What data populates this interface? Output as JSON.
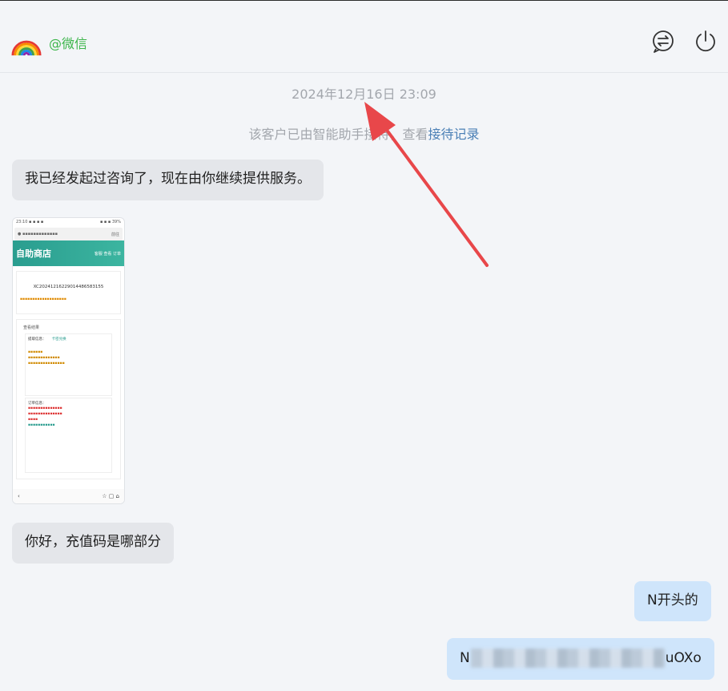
{
  "header": {
    "username": "@微信",
    "avatar_icon": "rainbow-icon",
    "switch_icon": "switch-chat-icon",
    "power_icon": "power-icon"
  },
  "chat": {
    "timestamp": "2024年12月16日 23:09",
    "notice_text": "该客户已由智能助手接待，查看",
    "notice_link": "接待记录",
    "messages": [
      {
        "side": "left",
        "text": "我已经发起过咨询了，现在由你继续提供服务。"
      },
      {
        "side": "left",
        "text": "你好，充值码是哪部分"
      },
      {
        "side": "right",
        "text": "N开头的"
      },
      {
        "side": "right",
        "prefix": "N",
        "suffix": "uOXo"
      }
    ]
  },
  "thumbnail": {
    "shop_title": "自助商店",
    "nav": "客服  查看  订单",
    "order_no": "XC20241216229014486583155",
    "tab_label": "查看结果",
    "section1": "提取信息：",
    "section1_link": "卡密兑换",
    "section2": "订单信息：",
    "go_btn": "前往"
  },
  "colors": {
    "accent_green": "#3bb54a",
    "link_blue": "#4a7fb5",
    "bubble_left": "#e4e6ea",
    "bubble_right": "#cfe5fb",
    "arrow_red": "#e8474a"
  }
}
